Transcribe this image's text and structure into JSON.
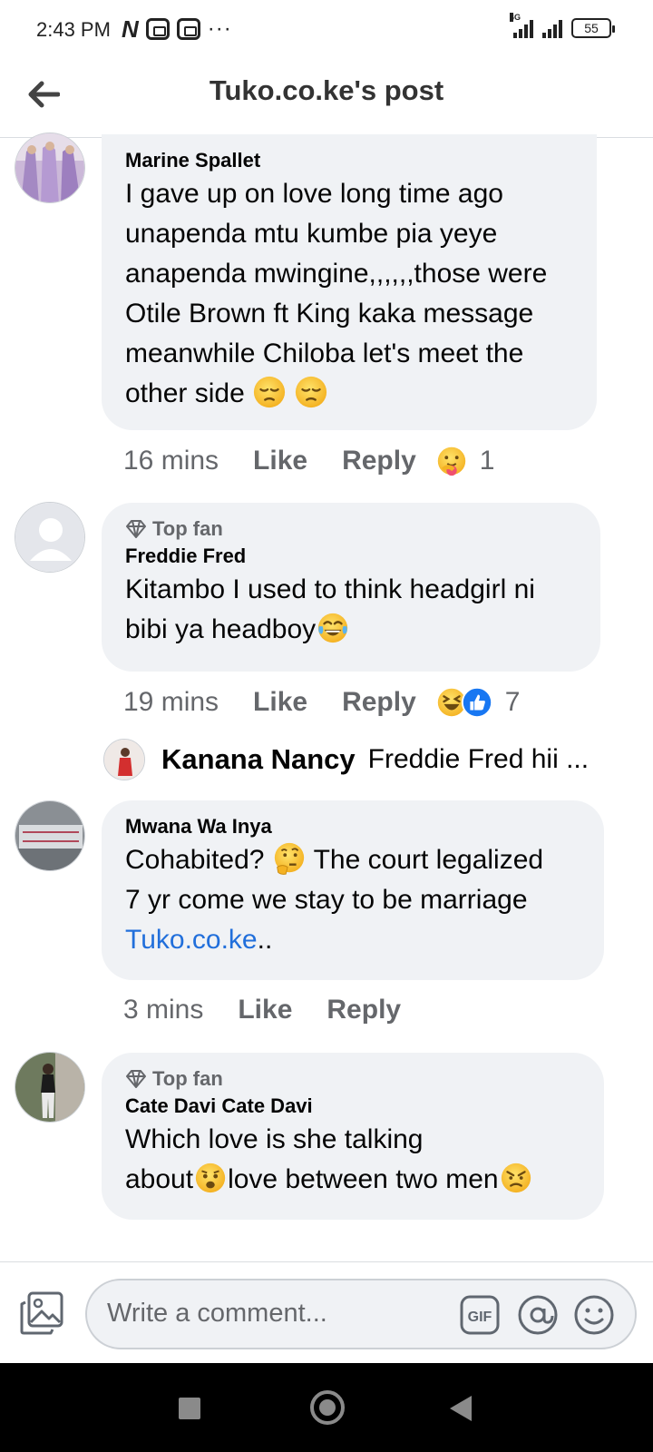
{
  "status_bar": {
    "time": "2:43 PM",
    "network_label": "4G",
    "battery": "55"
  },
  "header": {
    "title": "Tuko.co.ke's post"
  },
  "comments": [
    {
      "author": "Marine Spallet",
      "badge": "",
      "lines": [
        "I gave up on love  long time ago",
        "unapenda mtu kumbe pia yeye",
        "anapenda mwingine,,,,,,those were",
        "Otile Brown ft King kaka message",
        "meanwhile Chiloba let's meet the",
        "other side"
      ],
      "age": "16 mins",
      "like": "Like",
      "reply": "Reply",
      "reaction_count": "1"
    },
    {
      "author": "Freddie Fred",
      "badge": "Top fan",
      "lines": [
        "Kitambo I used to think headgirl ni",
        "bibi ya headboy"
      ],
      "age": "19 mins",
      "like": "Like",
      "reply": "Reply",
      "reaction_count": "7"
    },
    {
      "author": "Mwana Wa Inya",
      "badge": "",
      "lines": [
        "Cohabited?",
        "The court legalized",
        "7 yr come we stay to be marriage",
        "Tuko.co.ke",
        ".."
      ],
      "age": "3 mins",
      "like": "Like",
      "reply": "Reply"
    },
    {
      "author": "Cate Davi Cate Davi",
      "badge": "Top fan",
      "lines": [
        "Which love is she talking",
        "about",
        "love between two men"
      ]
    }
  ],
  "reply_preview": {
    "author": "Kanana Nancy",
    "text": "Freddie Fred hii ..."
  },
  "composer": {
    "placeholder": "Write a comment...",
    "gif_label": "GIF"
  },
  "colors": {
    "bubble": "#f0f2f5",
    "link": "#216fdb",
    "meta": "#65676b",
    "like_reaction": "#1877f2",
    "emoji_yellow": "#f7c33b"
  }
}
